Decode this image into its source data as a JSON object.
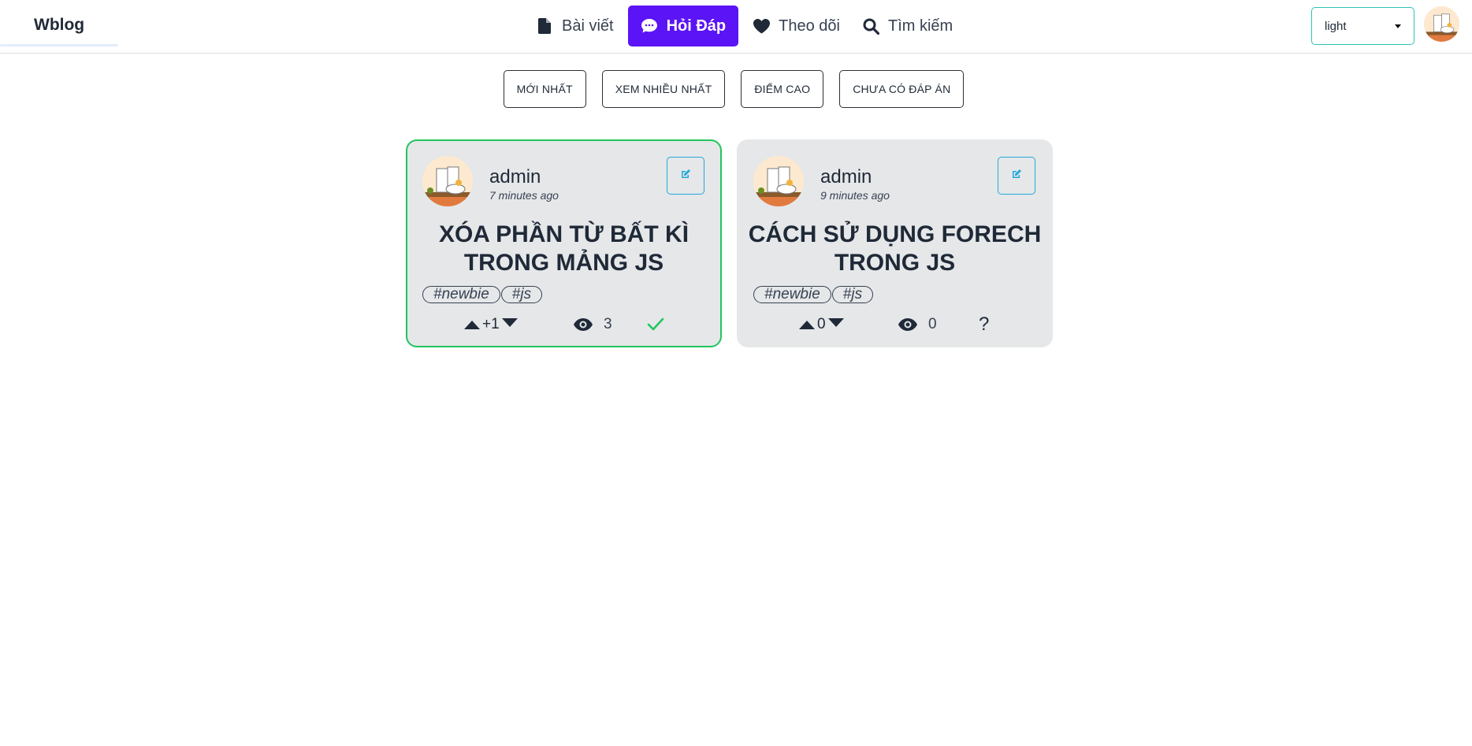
{
  "header": {
    "brand": "Wblog",
    "nav": [
      {
        "label": "Bài viết",
        "icon": "file-icon"
      },
      {
        "label": "Hỏi Đáp",
        "icon": "chat-bubble-icon",
        "active": true
      },
      {
        "label": "Theo dõi",
        "icon": "heart-icon"
      },
      {
        "label": "Tìm kiếm",
        "icon": "search-icon"
      }
    ],
    "theme_select": {
      "value": "light"
    },
    "accent_color": "#5b14f5"
  },
  "filters": [
    {
      "label": "MỚI NHẤT"
    },
    {
      "label": "XEM NHIỀU NHẤT"
    },
    {
      "label": "ĐIỂM CAO"
    },
    {
      "label": "CHƯA CÓ ĐÁP ÁN"
    }
  ],
  "questions": [
    {
      "author": "admin",
      "time": "7 minutes ago",
      "title": "XÓA PHẦN TỪ BẤT KÌ TRONG MẢNG JS",
      "tags": [
        "#newbie",
        "#js"
      ],
      "votes": "+1",
      "views": "3",
      "status_icon": "check-icon",
      "answered": true,
      "status_color": "#22c55e"
    },
    {
      "author": "admin",
      "time": "9 minutes ago",
      "title": "CÁCH SỬ DỤNG FORECH TRONG JS",
      "tags": [
        "#newbie",
        "#js"
      ],
      "votes": "0",
      "views": "0",
      "status_icon": "question-icon",
      "status_text": "?",
      "answered": false
    }
  ]
}
